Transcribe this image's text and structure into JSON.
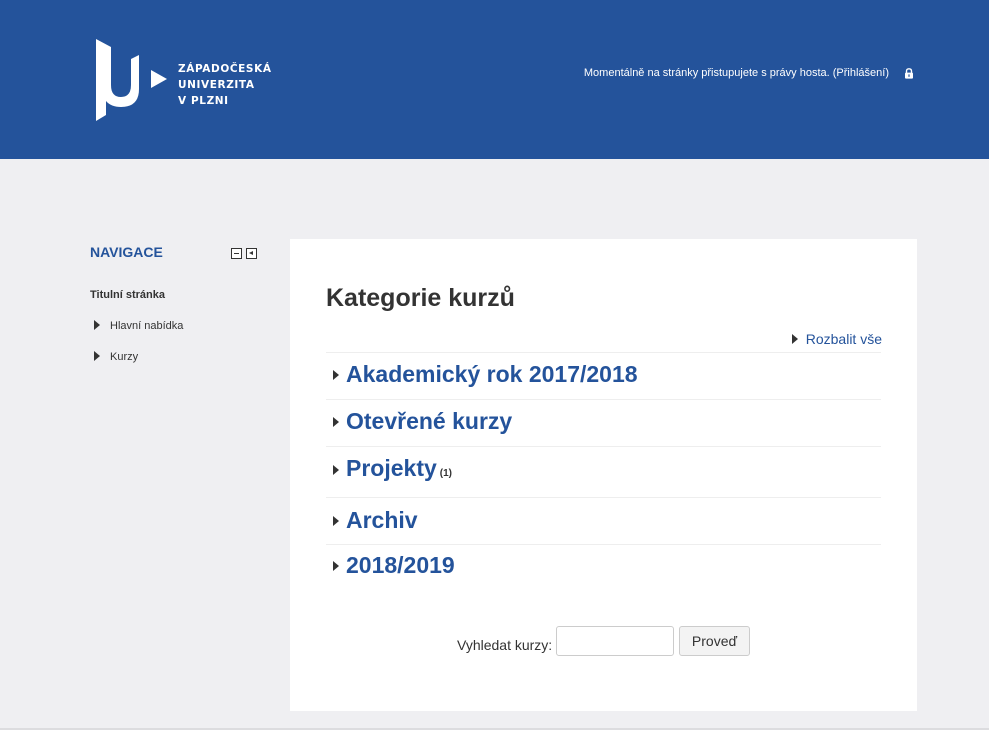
{
  "header": {
    "logo_lines": [
      "ZÁPADOČESKÁ",
      "UNIVERZITA",
      "V PLZNI"
    ],
    "guest_text": "Momentálně na stránky přistupujete s právy hosta.",
    "login_link": "(Přihlášení)",
    "background_color": "#24539b"
  },
  "navigation": {
    "title": "NAVIGACE",
    "home": "Titulní stránka",
    "items": [
      {
        "label": "Hlavní nabídka",
        "icon": "expand-triangle-icon"
      },
      {
        "label": "Kurzy",
        "icon": "expand-triangle-icon"
      }
    ]
  },
  "main": {
    "title": "Kategorie kurzů",
    "expand_all": "Rozbalit vše",
    "categories": [
      {
        "label": "Akademický rok 2017/2018",
        "count": ""
      },
      {
        "label": "Otevřené kurzy",
        "count": ""
      },
      {
        "label": "Projekty",
        "count": "(1)"
      },
      {
        "label": "Archiv",
        "count": ""
      },
      {
        "label": "2018/2019",
        "count": ""
      }
    ],
    "search": {
      "label": "Vyhledat kurzy:",
      "value": "",
      "button": "Proveď"
    },
    "link_color": "#24539b"
  }
}
